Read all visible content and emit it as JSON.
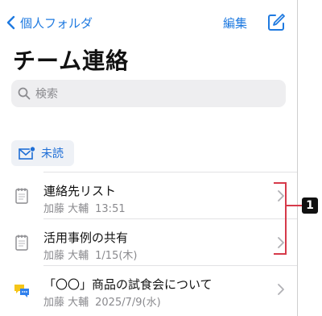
{
  "header": {
    "back_label": "個人フォルダ",
    "edit_label": "編集",
    "title": "チーム連絡"
  },
  "search": {
    "placeholder": "検索"
  },
  "filter": {
    "label": "未読"
  },
  "items": [
    {
      "name": "連絡先リスト",
      "author": "加藤 大輔",
      "time": "13:51",
      "icon": "memo-icon"
    },
    {
      "name": "活用事例の共有",
      "author": "加藤 大輔",
      "time": "1/15(木)",
      "icon": "memo-icon"
    },
    {
      "name": "「〇〇」商品の試食会について",
      "author": "加藤 大輔",
      "time": "2025/7/9(水)",
      "icon": "chat-bubbles-icon"
    }
  ],
  "annotation": {
    "label": "1"
  },
  "colors": {
    "accent": "#1f7ae0",
    "annotation": "#d63a4a"
  }
}
